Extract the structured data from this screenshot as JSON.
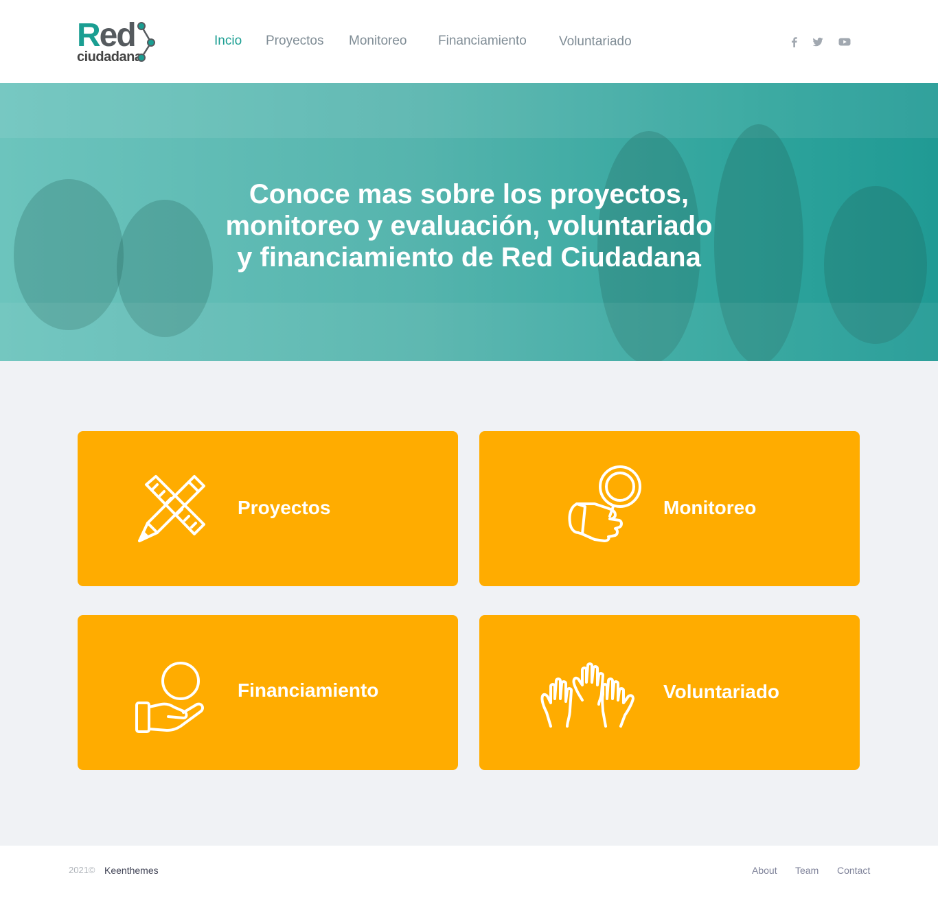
{
  "brand": {
    "logo_word": "Red",
    "logo_word_first": "R",
    "logo_word_rest": "ed",
    "logo_sub": "ciudadana",
    "accent_color": "#1a9e92",
    "card_color": "#ffac00"
  },
  "nav": {
    "items": [
      {
        "label": "Incio",
        "active": true
      },
      {
        "label": "Proyectos",
        "active": false
      },
      {
        "label": "Monitoreo",
        "active": false
      },
      {
        "label": "Financiamiento",
        "active": false
      },
      {
        "label": "Voluntariado",
        "active": false
      }
    ]
  },
  "social": [
    {
      "icon": "facebook-icon"
    },
    {
      "icon": "twitter-icon"
    },
    {
      "icon": "youtube-icon"
    }
  ],
  "hero": {
    "line1": "Conoce mas sobre los proyectos,",
    "line2": "monitoreo y evaluación, voluntariado",
    "line3": "y financiamiento de Red Ciudadana"
  },
  "cards": [
    {
      "label": "Proyectos",
      "icon": "pencil-ruler-icon"
    },
    {
      "label": "Monitoreo",
      "icon": "magnifier-hand-icon"
    },
    {
      "label": "Financiamiento",
      "icon": "coin-hand-icon"
    },
    {
      "label": "Voluntariado",
      "icon": "raised-hands-icon"
    }
  ],
  "footer": {
    "copyright": "2021©",
    "company": "Keenthemes",
    "links": [
      "About",
      "Team",
      "Contact"
    ]
  }
}
